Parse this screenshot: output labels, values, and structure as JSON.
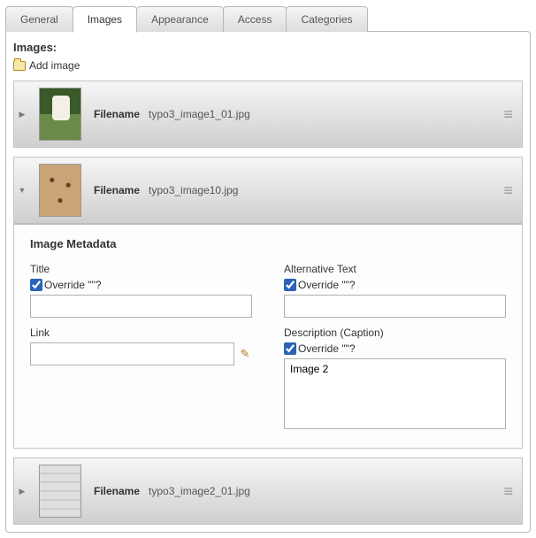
{
  "tabs": [
    {
      "label": "General",
      "active": false
    },
    {
      "label": "Images",
      "active": true
    },
    {
      "label": "Appearance",
      "active": false
    },
    {
      "label": "Access",
      "active": false
    },
    {
      "label": "Categories",
      "active": false
    }
  ],
  "section_label": "Images:",
  "add_image_label": "Add image",
  "filename_label": "Filename",
  "images": [
    {
      "filename": "typo3_image1_01.jpg",
      "expanded": false
    },
    {
      "filename": "typo3_image10.jpg",
      "expanded": true
    },
    {
      "filename": "typo3_image2_01.jpg",
      "expanded": false
    }
  ],
  "metadata": {
    "heading": "Image Metadata",
    "title": {
      "label": "Title",
      "override_label": "Override \"\"?",
      "override_checked": true,
      "value": ""
    },
    "alt": {
      "label": "Alternative Text",
      "override_label": "Override \"\"?",
      "override_checked": true,
      "value": ""
    },
    "link": {
      "label": "Link",
      "value": ""
    },
    "description": {
      "label": "Description (Caption)",
      "override_label": "Override \"\"?",
      "override_checked": true,
      "value": "Image 2"
    }
  }
}
